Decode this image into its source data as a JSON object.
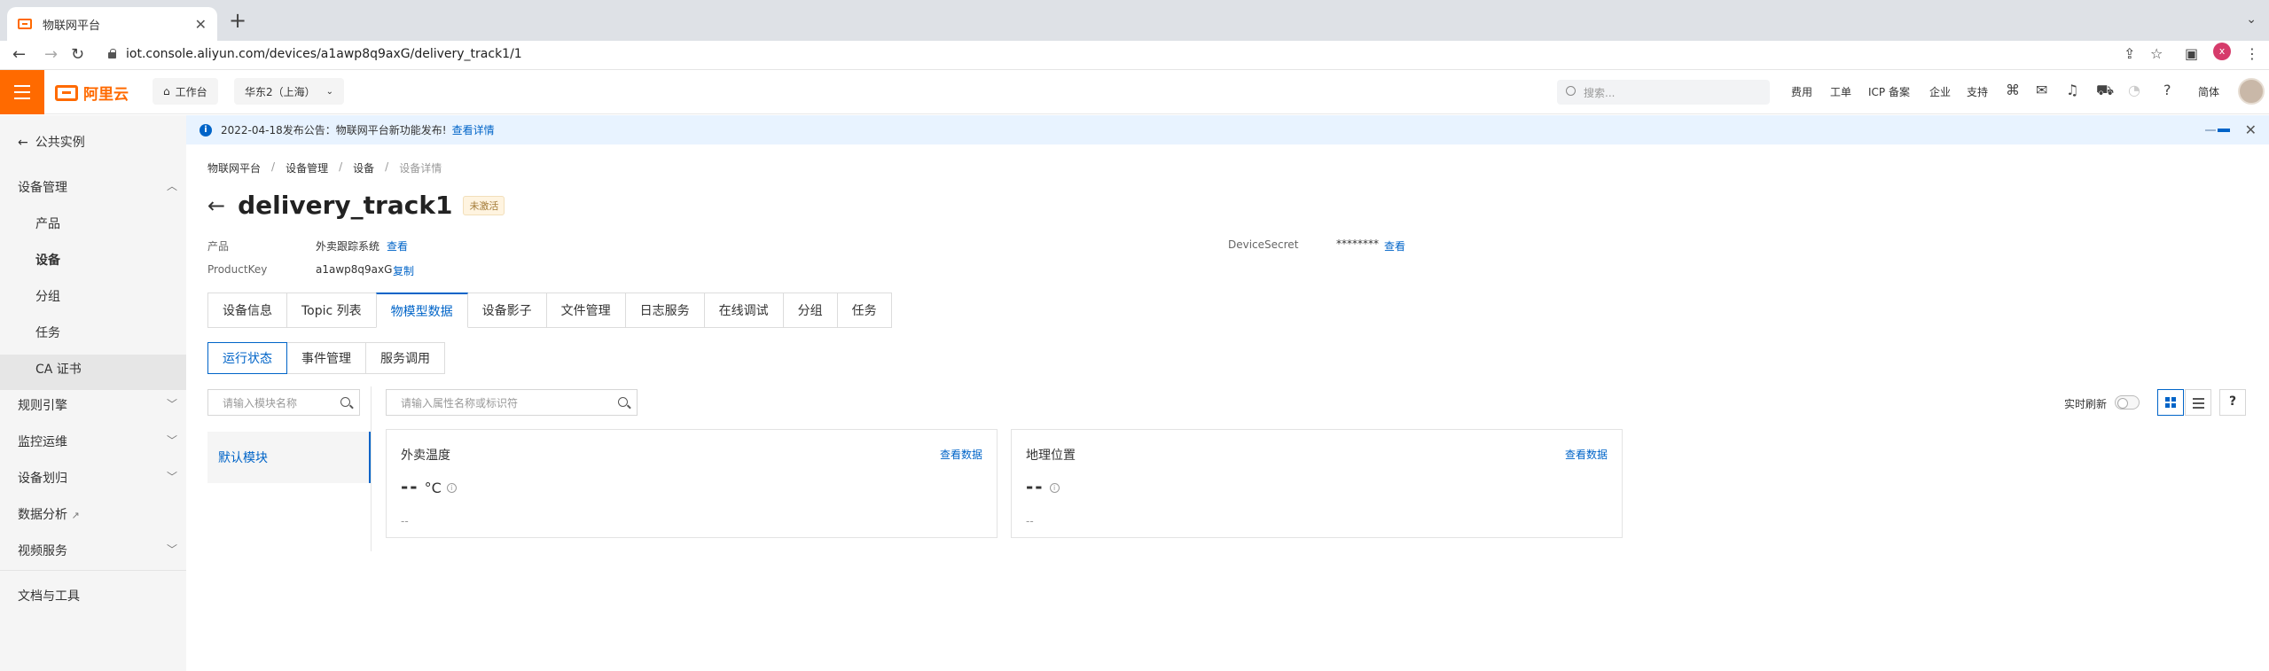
{
  "browser": {
    "tab_title": "物联网平台",
    "tab_close": "✕",
    "new_tab": "+",
    "url": "iot.console.aliyun.com/devices/a1awp8q9axG/delivery_track1/1",
    "profile_initial": "x"
  },
  "topbar": {
    "brand": "阿里云",
    "workbench": "工作台",
    "region": "华东2（上海）",
    "search_placeholder": "搜索...",
    "links": [
      "费用",
      "工单",
      "ICP 备案",
      "企业",
      "支持"
    ],
    "lang": "简体"
  },
  "sidebar": {
    "back_label": "公共实例",
    "device_mgmt": "设备管理",
    "sub_items": [
      "产品",
      "设备",
      "分组",
      "任务",
      "CA 证书"
    ],
    "sections": [
      "规则引擎",
      "监控运维",
      "设备划归",
      "数据分析",
      "视频服务"
    ],
    "docs": "文档与工具"
  },
  "notice": {
    "text": "2022-04-18发布公告：物联网平台新功能发布!",
    "link": "查看详情"
  },
  "breadcrumb": [
    "物联网平台",
    "设备管理",
    "设备",
    "设备详情"
  ],
  "device": {
    "name": "delivery_track1",
    "status": "未激活",
    "product_label": "产品",
    "product_value": "外卖跟踪系统",
    "product_link": "查看",
    "productkey_label": "ProductKey",
    "productkey_value": "a1awp8q9axG",
    "copy_link": "复制",
    "secret_label": "DeviceSecret",
    "secret_value": "********",
    "secret_link": "查看"
  },
  "tabs": [
    "设备信息",
    "Topic 列表",
    "物模型数据",
    "设备影子",
    "文件管理",
    "日志服务",
    "在线调试",
    "分组",
    "任务"
  ],
  "subtabs": [
    "运行状态",
    "事件管理",
    "服务调用"
  ],
  "filters": {
    "module_placeholder": "请输入模块名称",
    "property_placeholder": "请输入属性名称或标识符"
  },
  "modules": [
    "默认模块"
  ],
  "view": {
    "refresh_label": "实时刷新",
    "help": "?"
  },
  "cards": [
    {
      "title": "外卖温度",
      "link": "查看数据",
      "value": "--",
      "unit": "°C",
      "info": "i",
      "time": "--"
    },
    {
      "title": "地理位置",
      "link": "查看数据",
      "value": "--",
      "unit": "",
      "info": "i",
      "time": "--"
    }
  ]
}
